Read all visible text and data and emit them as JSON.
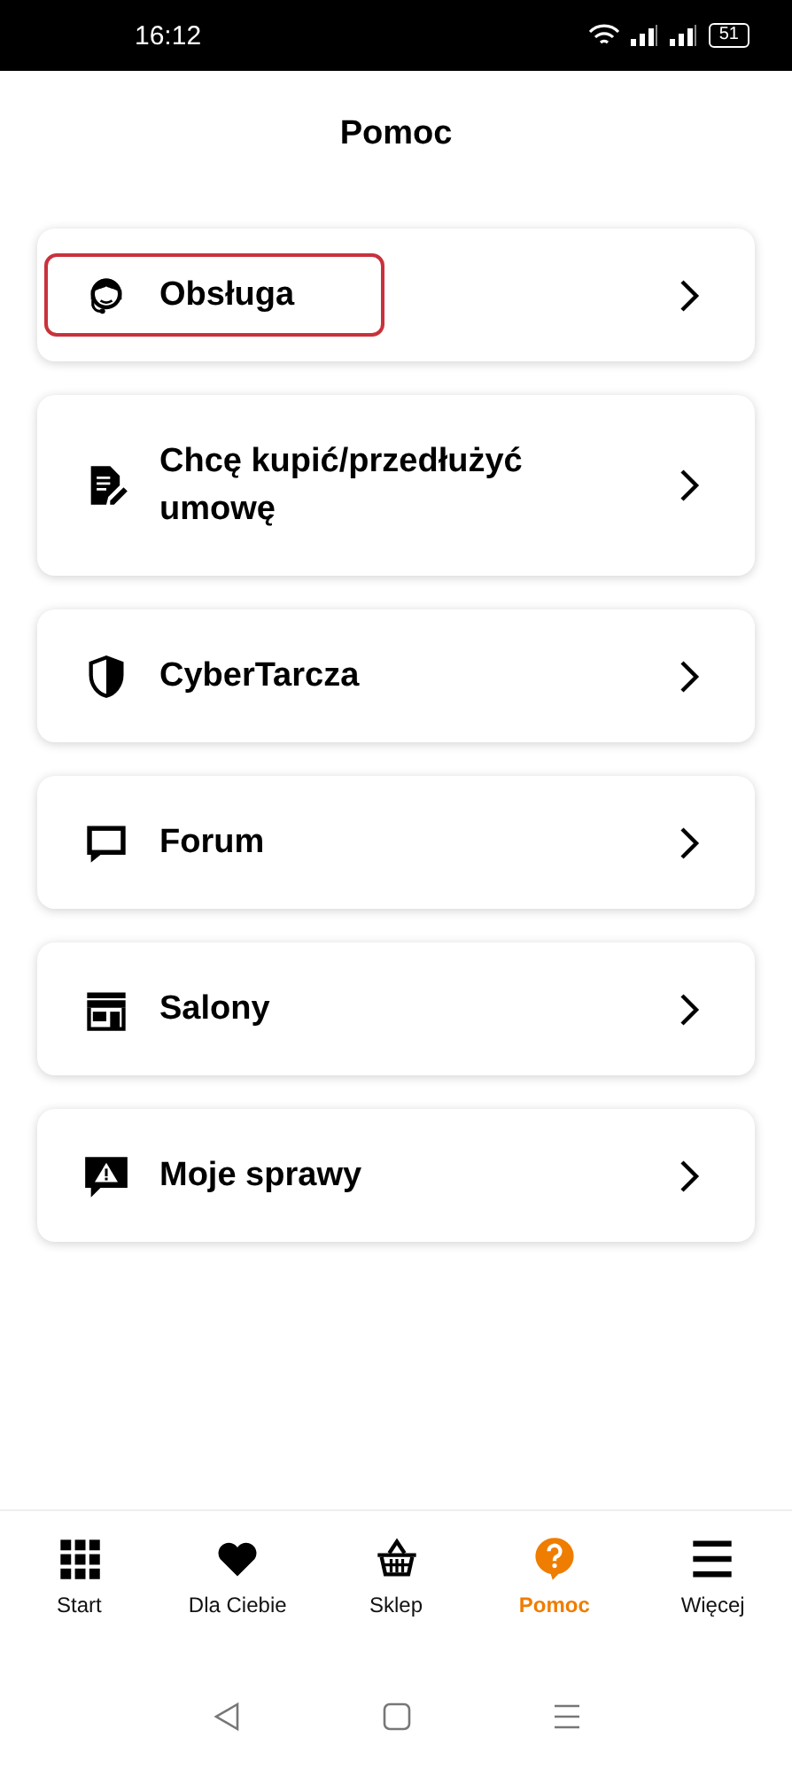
{
  "status_bar": {
    "time": "16:12",
    "battery": "51"
  },
  "header": {
    "title": "Pomoc"
  },
  "menu": [
    {
      "label": "Obsługa",
      "kind": "agent",
      "focused": true
    },
    {
      "label": "Chcę kupić/przedłużyć umowę",
      "kind": "document",
      "focused": false
    },
    {
      "label": "CyberTarcza",
      "kind": "shield",
      "focused": false
    },
    {
      "label": "Forum",
      "kind": "chat",
      "focused": false
    },
    {
      "label": "Salony",
      "kind": "store",
      "focused": false
    },
    {
      "label": "Moje sprawy",
      "kind": "alert",
      "focused": false
    }
  ],
  "bottom_nav": [
    {
      "label": "Start",
      "kind": "grid",
      "selected": false
    },
    {
      "label": "Dla Ciebie",
      "kind": "heart",
      "selected": false
    },
    {
      "label": "Sklep",
      "kind": "basket",
      "selected": false
    },
    {
      "label": "Pomoc",
      "kind": "help",
      "selected": true
    },
    {
      "label": "Więcej",
      "kind": "menu",
      "selected": false
    }
  ]
}
